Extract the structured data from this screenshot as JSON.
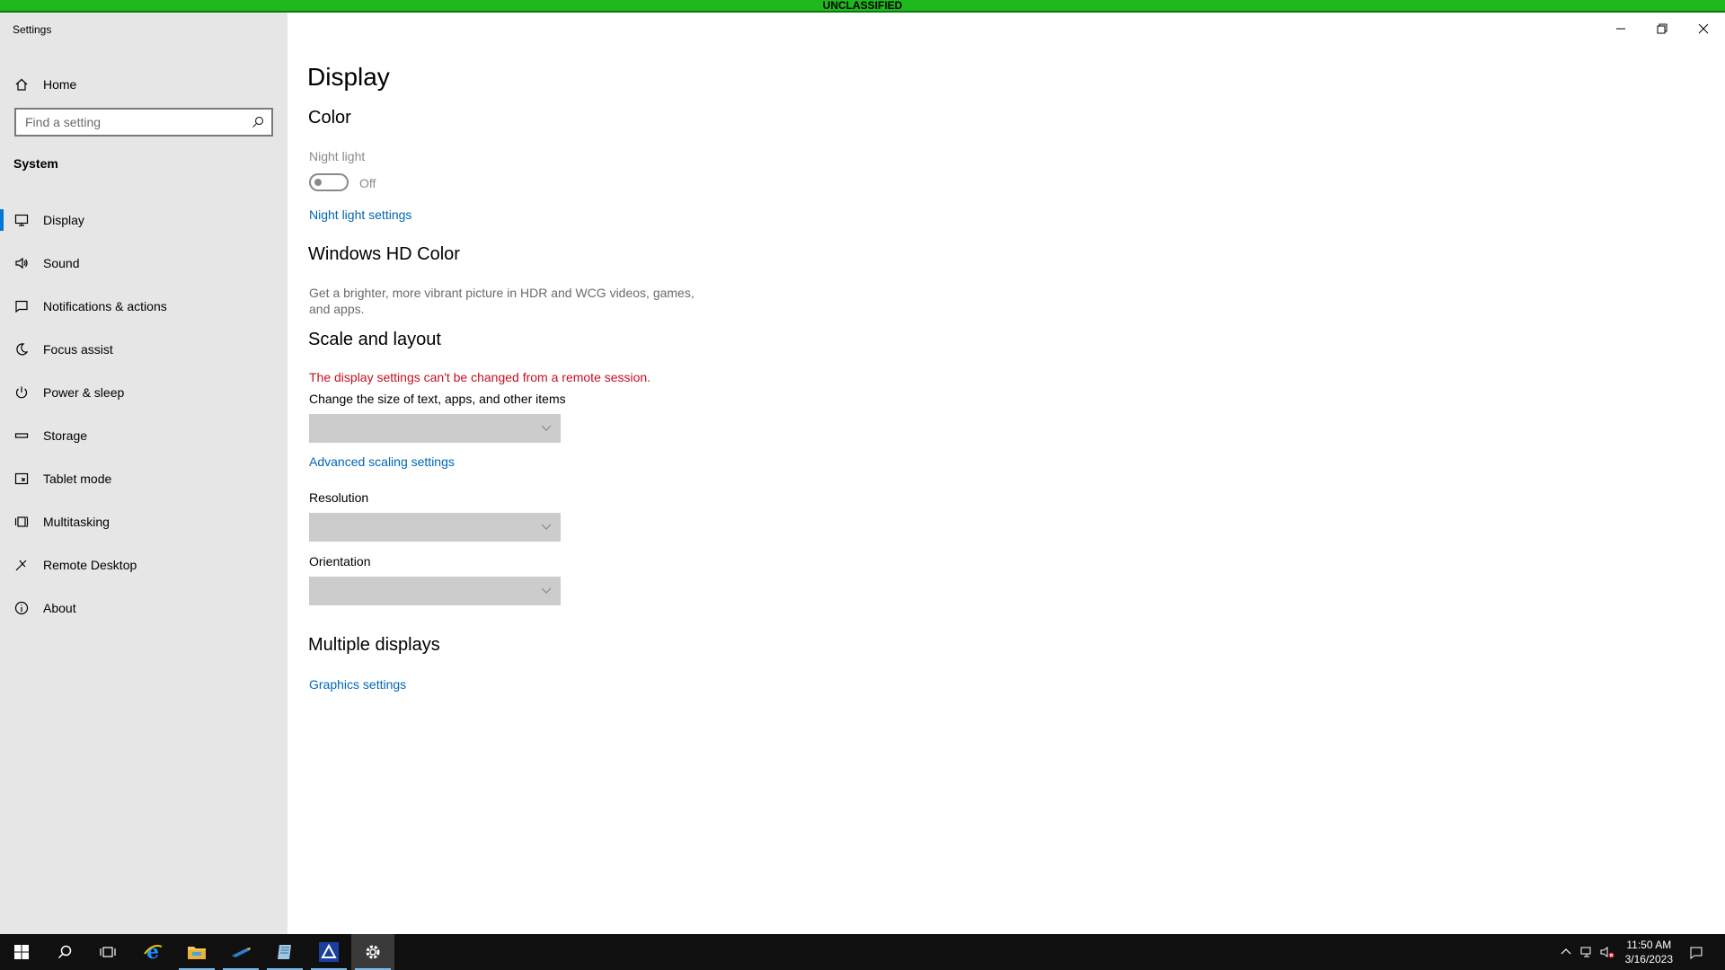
{
  "banner": {
    "text": "UNCLASSIFIED"
  },
  "window": {
    "title": "Settings"
  },
  "sidebar": {
    "home_label": "Home",
    "search_placeholder": "Find a setting",
    "section_title": "System",
    "items": [
      {
        "label": "Display",
        "icon": "monitor-icon",
        "selected": true
      },
      {
        "label": "Sound",
        "icon": "speaker-icon"
      },
      {
        "label": "Notifications & actions",
        "icon": "notification-icon"
      },
      {
        "label": "Focus assist",
        "icon": "moon-icon"
      },
      {
        "label": "Power & sleep",
        "icon": "power-icon"
      },
      {
        "label": "Storage",
        "icon": "storage-icon"
      },
      {
        "label": "Tablet mode",
        "icon": "tablet-icon"
      },
      {
        "label": "Multitasking",
        "icon": "multitasking-icon"
      },
      {
        "label": "Remote Desktop",
        "icon": "remote-desktop-icon"
      },
      {
        "label": "About",
        "icon": "info-icon"
      }
    ]
  },
  "main": {
    "title": "Display",
    "color_heading": "Color",
    "night_light_label": "Night light",
    "night_light_state": "Off",
    "night_light_link": "Night light settings",
    "hd_color_heading": "Windows HD Color",
    "hd_color_desc": "Get a brighter, more vibrant picture in HDR and WCG videos, games, and apps.",
    "scale_heading": "Scale and layout",
    "remote_error": "The display settings can't be changed from a remote session.",
    "scale_label": "Change the size of text, apps, and other items",
    "advanced_scaling_link": "Advanced scaling settings",
    "resolution_label": "Resolution",
    "orientation_label": "Orientation",
    "multiple_heading": "Multiple displays",
    "graphics_link": "Graphics settings"
  },
  "taskbar": {
    "time": "11:50 AM",
    "date": "3/16/2023"
  },
  "colors": {
    "accent": "#0078d7",
    "link": "#0066b4",
    "error": "#c50f1f",
    "banner": "#1fb81f"
  }
}
